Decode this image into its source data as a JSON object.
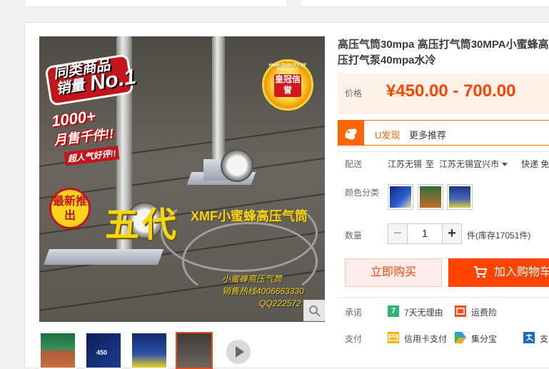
{
  "product": {
    "title": "高压气筒30mpa 高压打气筒30MPA小蜜蜂高压打气泵40mpa水冷",
    "price_label": "价格",
    "price": "¥450.00 - 700.00",
    "colors": {
      "accent": "#ff4400",
      "u_orange": "#ff6600"
    }
  },
  "image_overlay": {
    "badge_top": "同类商品",
    "badge_sales": "销量",
    "badge_no1": "No.1",
    "monthly_count": "1000+",
    "monthly_text": "月售千件!!",
    "popular": "超人气好评!!",
    "seal_ring": "HIGH QUALITY OF PRODUCT",
    "seal_center": "皇冠信誉",
    "newest": "最新推出",
    "generation": "五代",
    "brand": "XMF小蜜蜂高压气筒",
    "hotline_line1": "小蜜蜂高压气筒",
    "hotline_line2": "销售热线4006663330",
    "qq": "QQ222572"
  },
  "u_find": {
    "logo": "squirrel-icon",
    "label": "U发现",
    "more": "更多推荐"
  },
  "shipping": {
    "label": "配送",
    "from": "江苏无锡",
    "to_word": "至",
    "to": "江苏无锡宜兴市",
    "method": "快递 免"
  },
  "colors_section": {
    "label": "颜色分类"
  },
  "quantity": {
    "label": "数量",
    "minus": "−",
    "value": "1",
    "plus": "+",
    "stock": "件(库存17051件)"
  },
  "actions": {
    "buy_now": "立即购买",
    "add_cart": "加入购物车"
  },
  "promise": {
    "label": "承诺",
    "seven_day_icon": "7",
    "seven_day": "7天无理由",
    "freight_insurance": "运费险"
  },
  "payment": {
    "label": "支付",
    "credit_card": "信用卡支付",
    "jifenbao": "集分宝",
    "alipay_partial": "支"
  },
  "thumb_price": "450"
}
